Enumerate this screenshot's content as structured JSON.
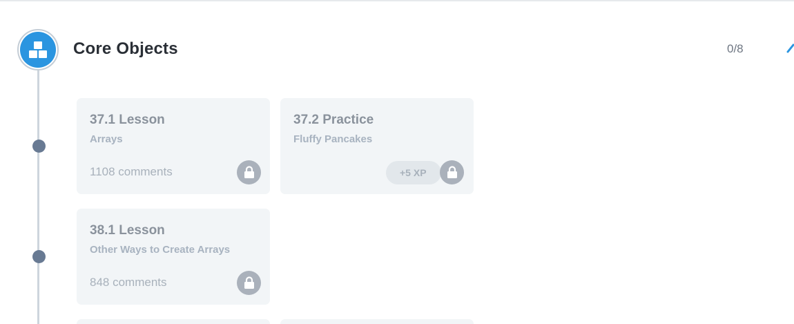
{
  "module": {
    "title": "Core Objects",
    "progress": "0/8",
    "icon": "blocks-icon",
    "accent_color": "#2b95e0"
  },
  "items": [
    {
      "title": "37.1 Lesson",
      "subtitle": "Arrays",
      "comments": "1108 comments",
      "locked": true
    },
    {
      "title": "37.2 Practice",
      "subtitle": "Fluffy Pancakes",
      "xp": "+5 XP",
      "locked": true
    },
    {
      "title": "38.1 Lesson",
      "subtitle": "Other Ways to Create Arrays",
      "comments": "848 comments",
      "locked": true
    }
  ]
}
